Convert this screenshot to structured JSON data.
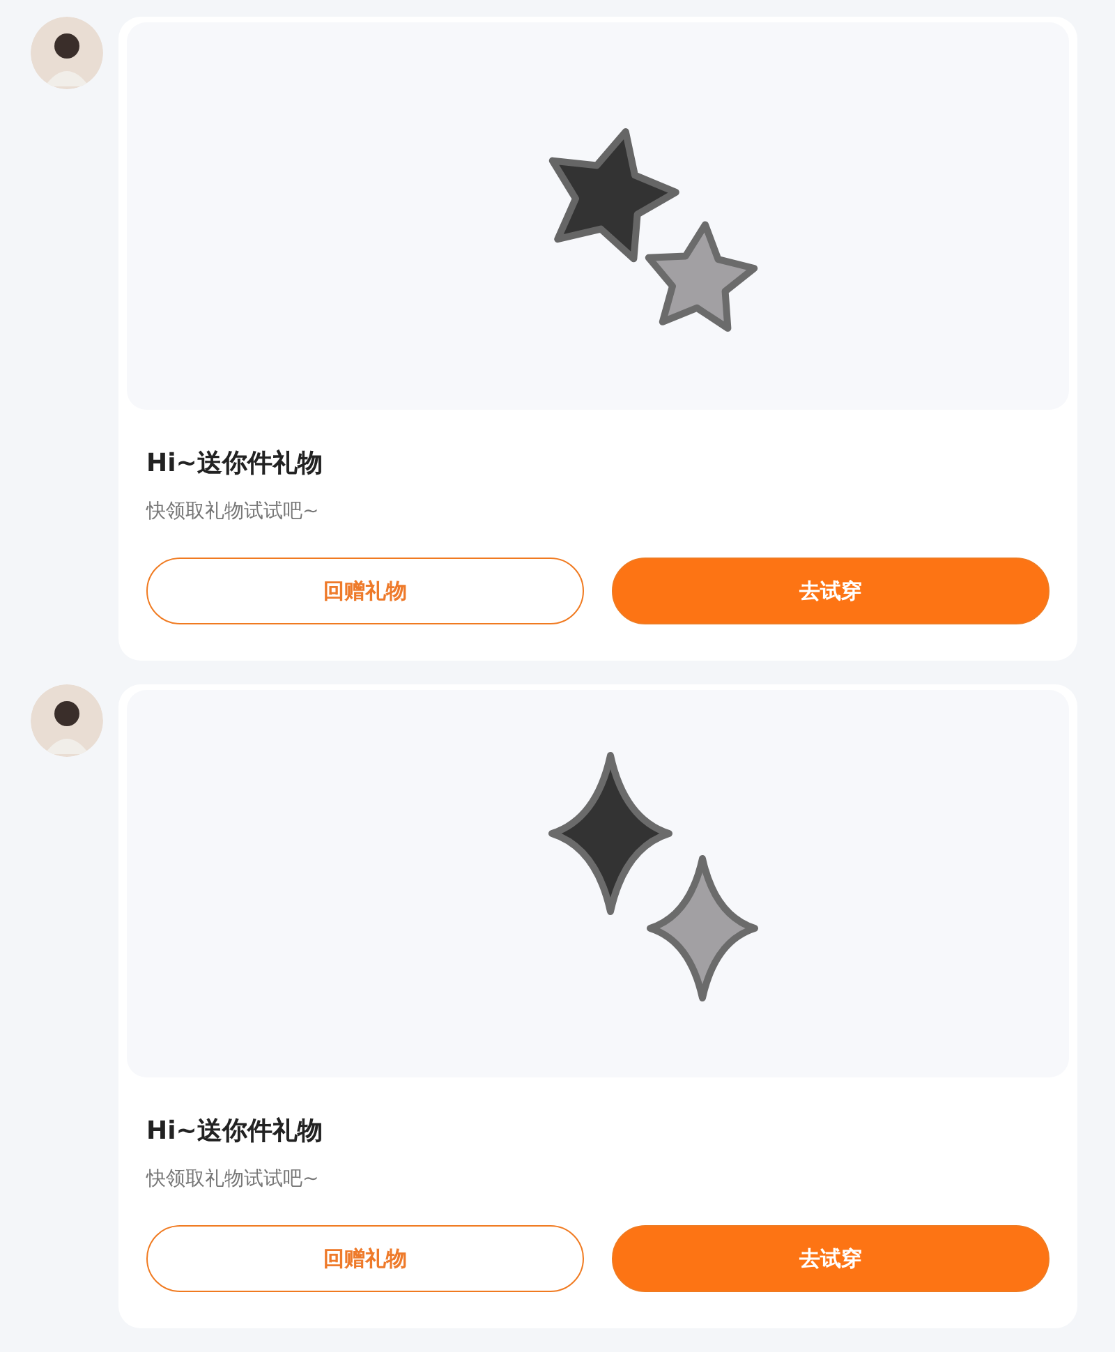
{
  "messages": [
    {
      "gift": {
        "kind": "stars"
      },
      "title": "Hi~送你件礼物",
      "subtitle": "快领取礼物试试吧~",
      "buttons": [
        {
          "label": "回赠礼物",
          "kind": "outline"
        },
        {
          "label": "去试穿",
          "kind": "filled"
        }
      ]
    },
    {
      "gift": {
        "kind": "sparkles"
      },
      "title": "Hi~送你件礼物",
      "subtitle": "快领取礼物试试吧~",
      "buttons": [
        {
          "label": "回赠礼物",
          "kind": "outline"
        },
        {
          "label": "去试穿",
          "kind": "filled"
        }
      ]
    }
  ]
}
